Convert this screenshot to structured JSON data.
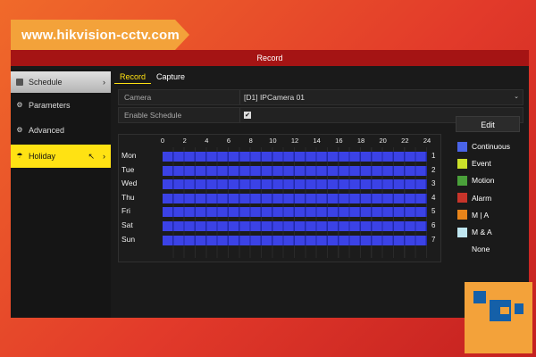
{
  "banner": {
    "text": "www.hikvision-cctv.com"
  },
  "window": {
    "title": "Record"
  },
  "sidebar": {
    "items": [
      {
        "label": "Schedule",
        "icon": "calendar-icon"
      },
      {
        "label": "Parameters",
        "icon": "gear-icon"
      },
      {
        "label": "Advanced",
        "icon": "advanced-gear-icon"
      },
      {
        "label": "Holiday",
        "icon": "umbrella-icon"
      }
    ]
  },
  "tabs": [
    {
      "label": "Record"
    },
    {
      "label": "Capture"
    }
  ],
  "form": {
    "camera_label": "Camera",
    "camera_value": "[D1] IPCamera 01",
    "enable_label": "Enable Schedule",
    "enable_checked": true
  },
  "schedule": {
    "hours": [
      "0",
      "2",
      "4",
      "6",
      "8",
      "10",
      "12",
      "14",
      "16",
      "18",
      "20",
      "22",
      "24"
    ],
    "days": [
      {
        "name": "Mon",
        "num": "1"
      },
      {
        "name": "Tue",
        "num": "2"
      },
      {
        "name": "Wed",
        "num": "3"
      },
      {
        "name": "Thu",
        "num": "4"
      },
      {
        "name": "Fri",
        "num": "5"
      },
      {
        "name": "Sat",
        "num": "6"
      },
      {
        "name": "Sun",
        "num": "7"
      }
    ],
    "fill_mode": "Continuous",
    "coverage": "all-day"
  },
  "legend": {
    "edit_label": "Edit",
    "items": [
      {
        "label": "Continuous",
        "color": "#4a64e8"
      },
      {
        "label": "Event",
        "color": "#cbe02a"
      },
      {
        "label": "Motion",
        "color": "#4aa03a"
      },
      {
        "label": "Alarm",
        "color": "#c8342a"
      },
      {
        "label": "M | A",
        "color": "#e8841a"
      },
      {
        "label": "M & A",
        "color": "#bfe6f0"
      },
      {
        "label": "None",
        "color": "#1a1a1a"
      }
    ]
  },
  "colors": {
    "accent": "#ffe213",
    "titlebar": "#a51414",
    "brand_orange": "#f3a23a"
  }
}
